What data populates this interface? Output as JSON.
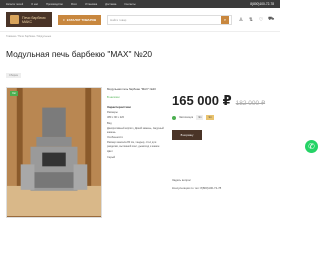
{
  "topbar": {
    "nav": [
      "Каталог печей",
      "О нас",
      "Производство",
      "Фото",
      "Установка",
      "Доставка",
      "Контакты"
    ],
    "phone": "8(800)100-72-78"
  },
  "header": {
    "logo_text": "Печи барбекю МАКС",
    "catalog_label": "КАТАЛОГ ТОВАРОВ",
    "search_placeholder": "Найти товар",
    "search_icon": "search-icon",
    "icons": [
      "user-icon",
      "compare-icon",
      "heart-icon",
      "cart-icon"
    ]
  },
  "breadcrumb": "Главная / Печи барбекю / Модульные",
  "page_title": "Модульная печь барбекю \"MAX\" №20",
  "tag": "Сборка",
  "product": {
    "badge": "Хит",
    "name": "Модульная печь барбекю \"MAX\" №20",
    "stock": "В наличии",
    "section_title": "Характеристики",
    "lines": [
      "Размеры",
      "380 x 90 x 220",
      "Вид",
      "Декоративный кирпич, Дикий камень, Ажурный камень",
      "Особенности",
      "Размер мангала 80 см, тандыр, стол для разделки, вытяжной зонт, дымоход и камин",
      "Цвет",
      "Серый"
    ],
    "price_now": "165 000 ₽",
    "price_old": "182 000 ₽",
    "avail_label": "Экспозиция",
    "avail_pills": [
      "Эл",
      "Эл"
    ],
    "cart_label": "В корзину",
    "ask_label": "Задать вопрос",
    "call_label": "Консультация по тел: 8(800)100-72-78"
  },
  "colors": {
    "accent": "#c8873e",
    "brand": "#4a3427",
    "ok": "#4caf50"
  }
}
